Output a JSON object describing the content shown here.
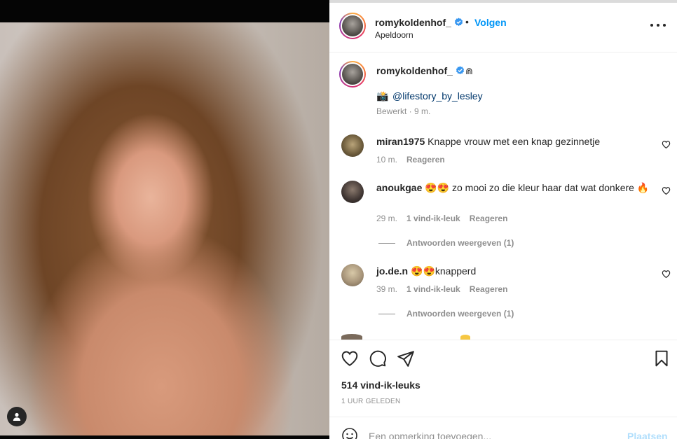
{
  "post": {
    "username": "romykoldenhof_",
    "follow_label": "Volgen",
    "separator": "•",
    "location": "Apeldoorn",
    "caption": {
      "username": "romykoldenhof_",
      "extra_glyph": "⋒",
      "camera_emoji": "📸",
      "mention": "@lifestory_by_lesley",
      "meta": "Bewerkt · 9 m."
    },
    "comments": [
      {
        "username": "miran1975",
        "text": " Knappe vrouw met een knap gezinnetje",
        "time": "10 m.",
        "likes": "",
        "reply_label": "Reageren"
      },
      {
        "username": "anoukgae",
        "text": " 😍😍 zo mooi zo die kleur haar dat wat donkere 🔥",
        "time": "29 m.",
        "likes": "1 vind-ik-leuk",
        "reply_label": "Reageren",
        "view_replies": "Antwoorden weergeven (1)"
      },
      {
        "username": "jo.de.n",
        "text": " 😍😍knapperd",
        "time": "39 m.",
        "likes": "1 vind-ik-leuk",
        "reply_label": "Reageren",
        "view_replies": "Antwoorden weergeven (1)"
      }
    ],
    "likes": "514 vind-ik-leuks",
    "posted": "1 UUR GELEDEN",
    "comment_placeholder": "Een opmerking toevoegen...",
    "post_label": "Plaatsen"
  },
  "colors": {
    "accent": "#0095f6",
    "mention": "#00376b",
    "muted": "#8e8e8e",
    "text": "#262626",
    "post_disabled": "#b2dffc"
  },
  "icons": [
    "verified-badge-icon",
    "more-options-icon",
    "heart-icon",
    "comment-icon",
    "share-icon",
    "bookmark-icon",
    "emoji-icon",
    "user-tag-icon"
  ]
}
